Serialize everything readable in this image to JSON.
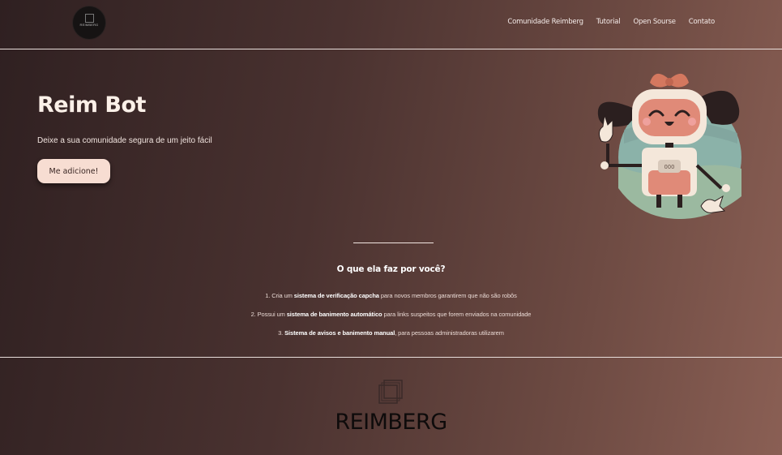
{
  "header": {
    "logo_text": "REIMBERG",
    "nav": [
      "Comunidade Reimberg",
      "Tutorial",
      "Open Sourse",
      "Contato"
    ]
  },
  "hero": {
    "title": "Reim Bot",
    "subtitle": "Deixe a sua comunidade segura de um jeito fácil",
    "cta_label": "Me adicione!",
    "robot_badge": "OOO"
  },
  "features": {
    "title": "O que ela faz por você?",
    "items": [
      {
        "prefix": "1. Cria um ",
        "bold": "sistema de verificação capcha",
        "suffix": " para novos membros garantirem que não são robôs"
      },
      {
        "prefix": "2. Possui um ",
        "bold": "sistema de banimento automático",
        "suffix": " para links suspeitos que forem enviados na comunidade"
      },
      {
        "prefix": "3. ",
        "bold": "Sistema de avisos e banimento manual",
        "suffix": ", para pessoas administradoras utilizarem"
      }
    ]
  },
  "footer": {
    "brand": "REIMBERG"
  },
  "colors": {
    "accent": "#f7ddd2",
    "robot_pink": "#e08a78",
    "robot_hair": "#2b1f1f"
  }
}
